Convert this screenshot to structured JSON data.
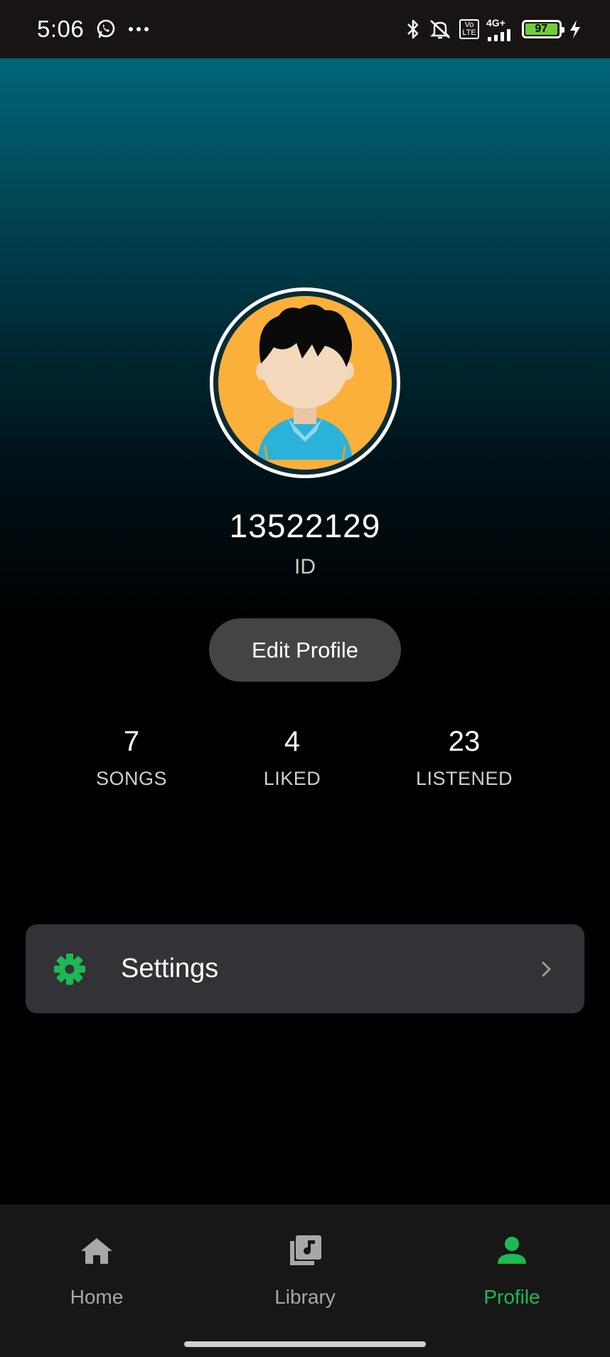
{
  "status_bar": {
    "time": "5:06",
    "network_label": "4G+",
    "volte_label": "Vo LTE",
    "battery_level": "97",
    "battery_fraction": 0.97
  },
  "profile": {
    "user_id": "13522129",
    "user_id_label": "ID",
    "edit_button_label": "Edit Profile"
  },
  "stats": [
    {
      "value": "7",
      "label": "SONGS"
    },
    {
      "value": "4",
      "label": "LIKED"
    },
    {
      "value": "23",
      "label": "LISTENED"
    }
  ],
  "settings": {
    "label": "Settings"
  },
  "bottom_nav": {
    "items": [
      {
        "label": "Home",
        "icon": "home-icon",
        "active": false
      },
      {
        "label": "Library",
        "icon": "library-icon",
        "active": false
      },
      {
        "label": "Profile",
        "icon": "profile-icon",
        "active": true
      }
    ]
  },
  "colors": {
    "accent": "#1db954",
    "gradient_top": "#006679",
    "background": "#000000",
    "card": "#333236",
    "nav_bg": "#171717"
  }
}
